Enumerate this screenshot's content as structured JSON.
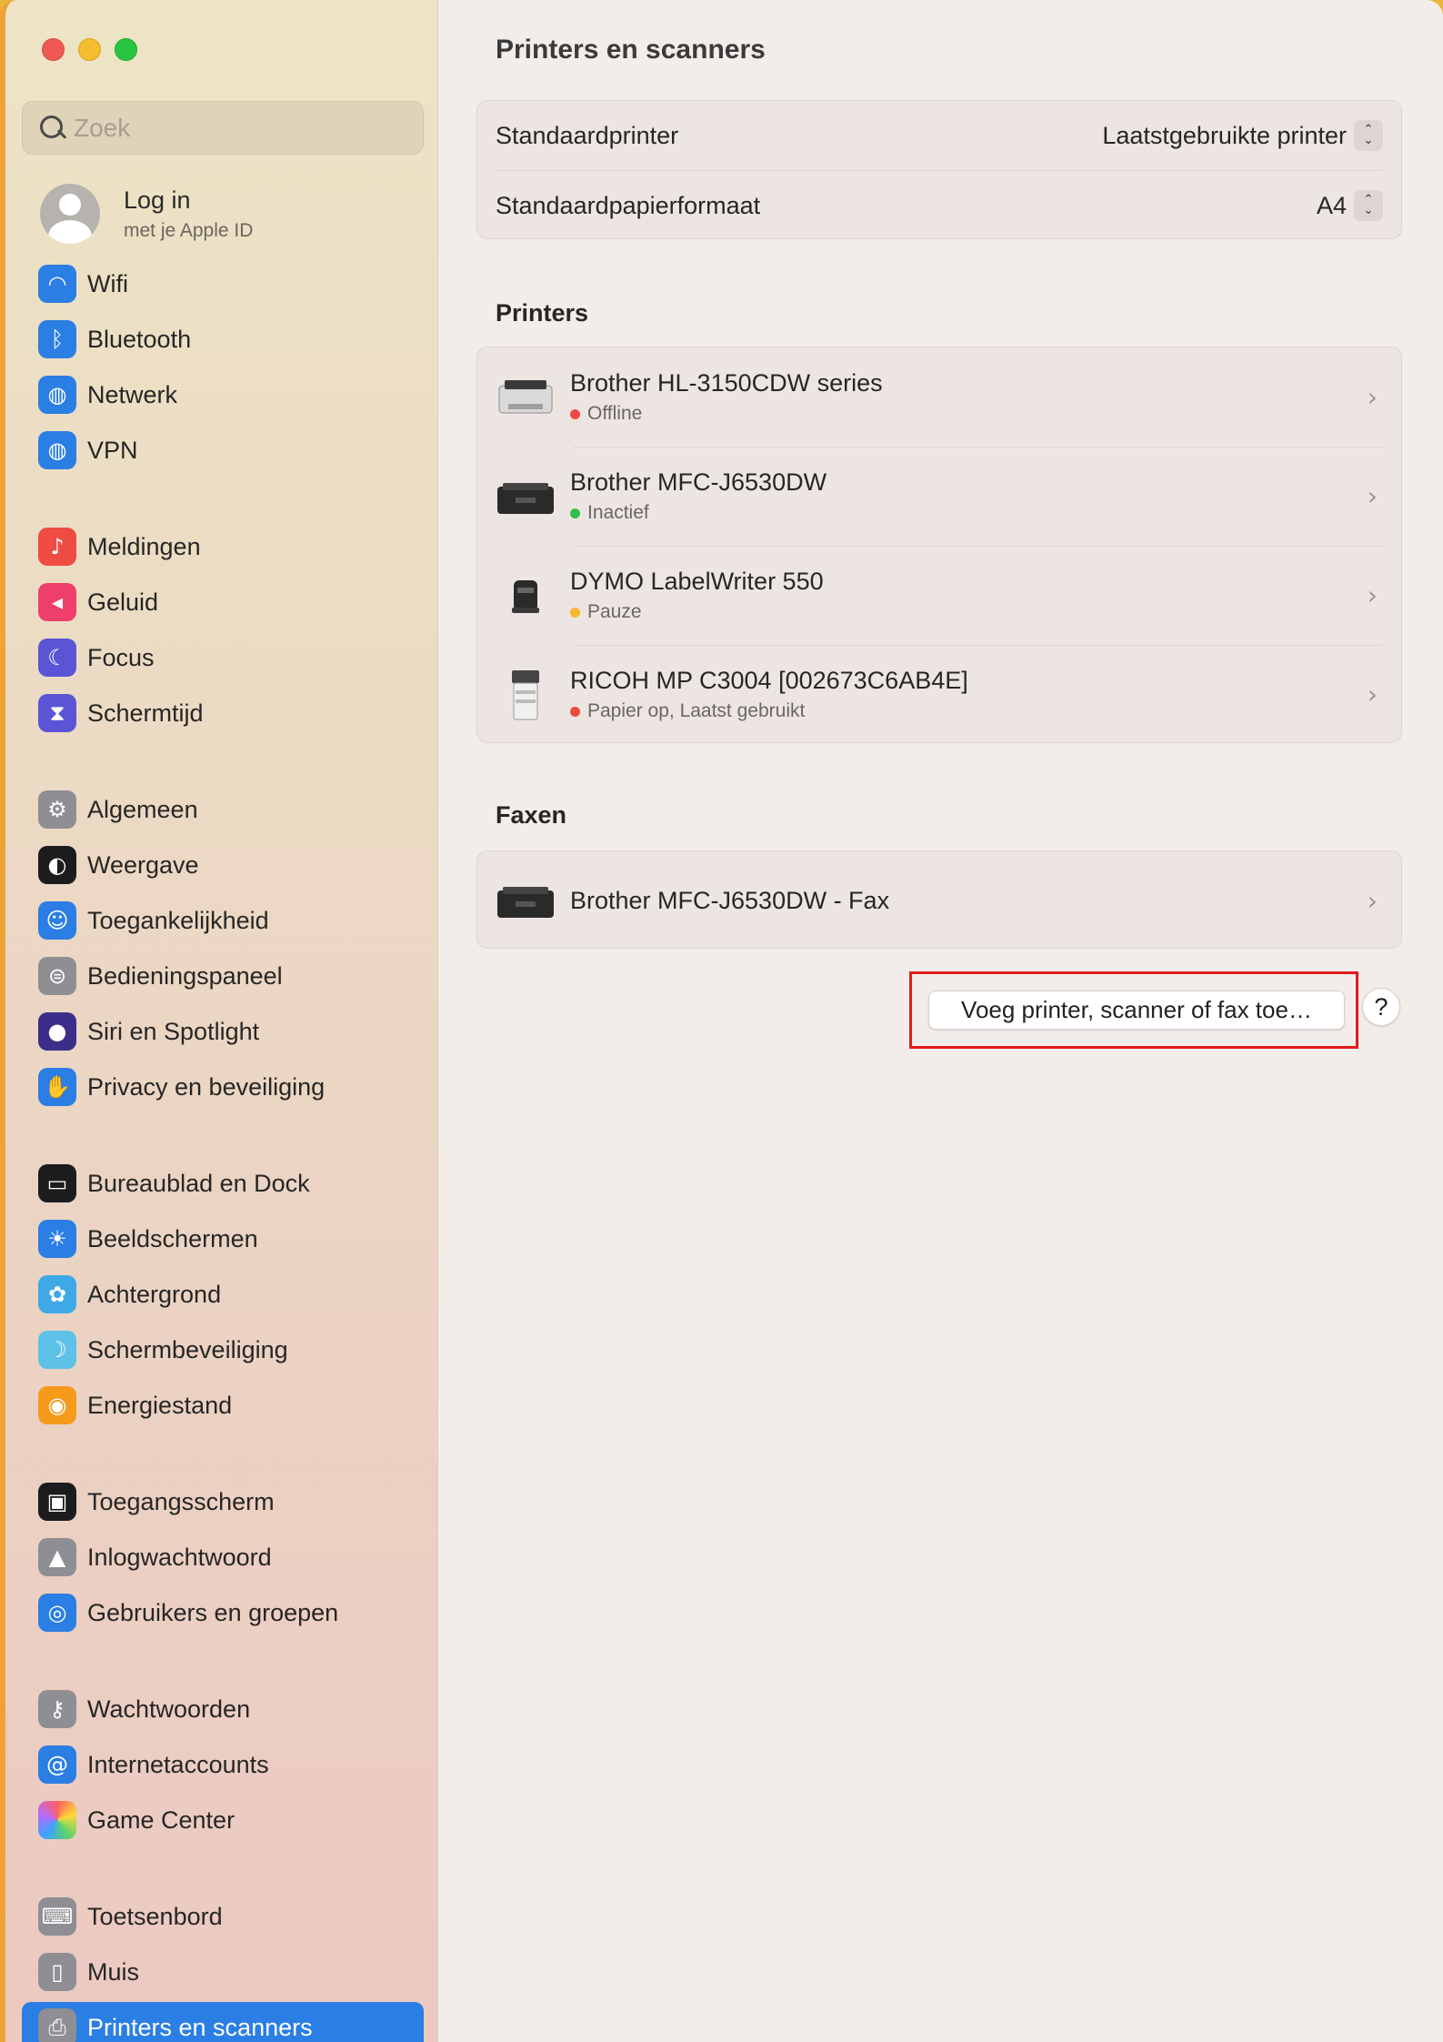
{
  "window": {
    "title": "Printers en scanners"
  },
  "sidebar": {
    "search_placeholder": "Zoek",
    "account": {
      "title": "Log in",
      "subtitle": "met je Apple ID"
    },
    "items": [
      {
        "label": "Wifi",
        "icon": "wifi-icon",
        "color": "#2b7ee3"
      },
      {
        "label": "Bluetooth",
        "icon": "bluetooth-icon",
        "color": "#2b7ee3"
      },
      {
        "label": "Netwerk",
        "icon": "globe-icon",
        "color": "#2b7ee3"
      },
      {
        "label": "VPN",
        "icon": "vpn-globe-icon",
        "color": "#2b7ee3"
      },
      {
        "label": "Meldingen",
        "icon": "bell-icon",
        "color": "#ee4b42"
      },
      {
        "label": "Geluid",
        "icon": "speaker-icon",
        "color": "#ee3f6c"
      },
      {
        "label": "Focus",
        "icon": "moon-icon",
        "color": "#5b55d6"
      },
      {
        "label": "Schermtijd",
        "icon": "hourglass-icon",
        "color": "#5b55d6"
      },
      {
        "label": "Algemeen",
        "icon": "gear-icon",
        "color": "#8e8e93"
      },
      {
        "label": "Weergave",
        "icon": "appearance-icon",
        "color": "#1c1c1e"
      },
      {
        "label": "Toegankelijkheid",
        "icon": "accessibility-icon",
        "color": "#2b7ee3"
      },
      {
        "label": "Bedieningspaneel",
        "icon": "control-center-icon",
        "color": "#8e8e93"
      },
      {
        "label": "Siri en Spotlight",
        "icon": "siri-icon",
        "color": "#3b2e8a"
      },
      {
        "label": "Privacy en beveiliging",
        "icon": "hand-icon",
        "color": "#2b7ee3"
      },
      {
        "label": "Bureaublad en Dock",
        "icon": "dock-icon",
        "color": "#1c1c1e"
      },
      {
        "label": "Beeldschermen",
        "icon": "sun-icon",
        "color": "#2b7ee3"
      },
      {
        "label": "Achtergrond",
        "icon": "flower-icon",
        "color": "#3fa9e8"
      },
      {
        "label": "Schermbeveiliging",
        "icon": "screensaver-icon",
        "color": "#5ec1e8"
      },
      {
        "label": "Energiestand",
        "icon": "bulb-icon",
        "color": "#f59b1b"
      },
      {
        "label": "Toegangsscherm",
        "icon": "lock-screen-icon",
        "color": "#1c1c1e"
      },
      {
        "label": "Inlogwachtwoord",
        "icon": "lock-icon",
        "color": "#8e8e93"
      },
      {
        "label": "Gebruikers en groepen",
        "icon": "users-icon",
        "color": "#2b7ee3"
      },
      {
        "label": "Wachtwoorden",
        "icon": "key-icon",
        "color": "#8e8e93"
      },
      {
        "label": "Internetaccounts",
        "icon": "at-icon",
        "color": "#2b7ee3"
      },
      {
        "label": "Game Center",
        "icon": "game-center-icon",
        "color": "#ffffff"
      },
      {
        "label": "Toetsenbord",
        "icon": "keyboard-icon",
        "color": "#8e8e93"
      },
      {
        "label": "Muis",
        "icon": "mouse-icon",
        "color": "#8e8e93"
      },
      {
        "label": "Printers en scanners",
        "icon": "printer-icon",
        "color": "#8e8e93",
        "active": true
      }
    ]
  },
  "main": {
    "title": "Printers en scanners",
    "defaults": [
      {
        "label": "Standaardprinter",
        "value": "Laatstgebruikte printer"
      },
      {
        "label": "Standaardpapierformaat",
        "value": "A4"
      }
    ],
    "printers_title": "Printers",
    "printers": [
      {
        "name": "Brother HL-3150CDW series",
        "status": "Offline",
        "status_color": "#ee4b42"
      },
      {
        "name": "Brother MFC-J6530DW",
        "status": "Inactief",
        "status_color": "#2fbf4a"
      },
      {
        "name": "DYMO LabelWriter 550",
        "status": "Pauze",
        "status_color": "#f5b82e"
      },
      {
        "name": "RICOH MP C3004 [002673C6AB4E]",
        "status": "Papier op, Laatst gebruikt",
        "status_color": "#ee4b42"
      }
    ],
    "fax_title": "Faxen",
    "faxes": [
      {
        "name": "Brother MFC-J6530DW - Fax"
      }
    ],
    "add_button_label": "Voeg printer, scanner of fax toe…",
    "help_label": "?"
  }
}
